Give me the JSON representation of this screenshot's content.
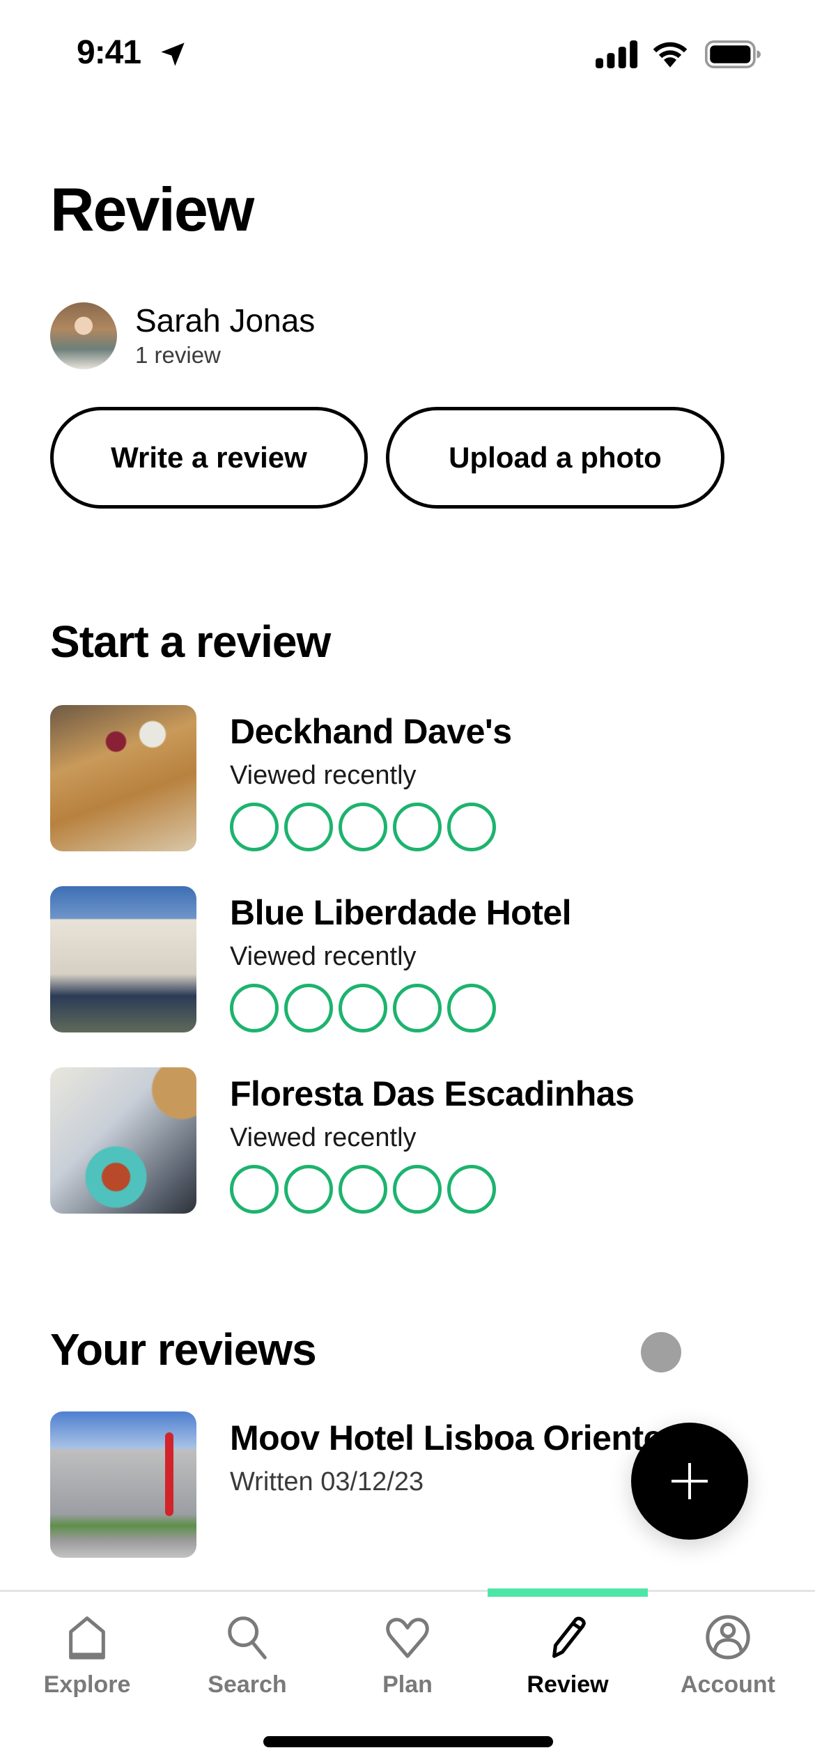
{
  "status_bar": {
    "time": "9:41",
    "icons": [
      "location-arrow-icon",
      "cellular-signal-icon",
      "wifi-icon",
      "battery-icon"
    ]
  },
  "header": {
    "title": "Review"
  },
  "profile": {
    "name": "Sarah Jonas",
    "review_count": "1 review"
  },
  "actions": {
    "write_review": "Write a review",
    "upload_photo": "Upload a photo"
  },
  "start_review": {
    "title": "Start a review",
    "items": [
      {
        "name": "Deckhand Dave's",
        "subtitle": "Viewed recently",
        "rating": 0,
        "max_rating": 5
      },
      {
        "name": "Blue Liberdade Hotel",
        "subtitle": "Viewed recently",
        "rating": 0,
        "max_rating": 5
      },
      {
        "name": "Floresta Das Escadinhas",
        "subtitle": "Viewed recently",
        "rating": 0,
        "max_rating": 5
      }
    ]
  },
  "your_reviews": {
    "title": "Your reviews",
    "items": [
      {
        "name": "Moov Hotel Lisboa Oriente",
        "subtitle": "Written 03/12/23"
      }
    ]
  },
  "fab": {
    "icon": "plus-icon"
  },
  "tabbar": {
    "active": "Review",
    "items": [
      {
        "label": "Explore",
        "icon": "home-icon"
      },
      {
        "label": "Search",
        "icon": "search-icon"
      },
      {
        "label": "Plan",
        "icon": "heart-icon"
      },
      {
        "label": "Review",
        "icon": "pencil-icon"
      },
      {
        "label": "Account",
        "icon": "account-icon"
      }
    ]
  },
  "colors": {
    "accent_green": "#1db36e",
    "tab_indicator": "#4ee6a7",
    "inactive_tab": "#7a7a7a"
  }
}
